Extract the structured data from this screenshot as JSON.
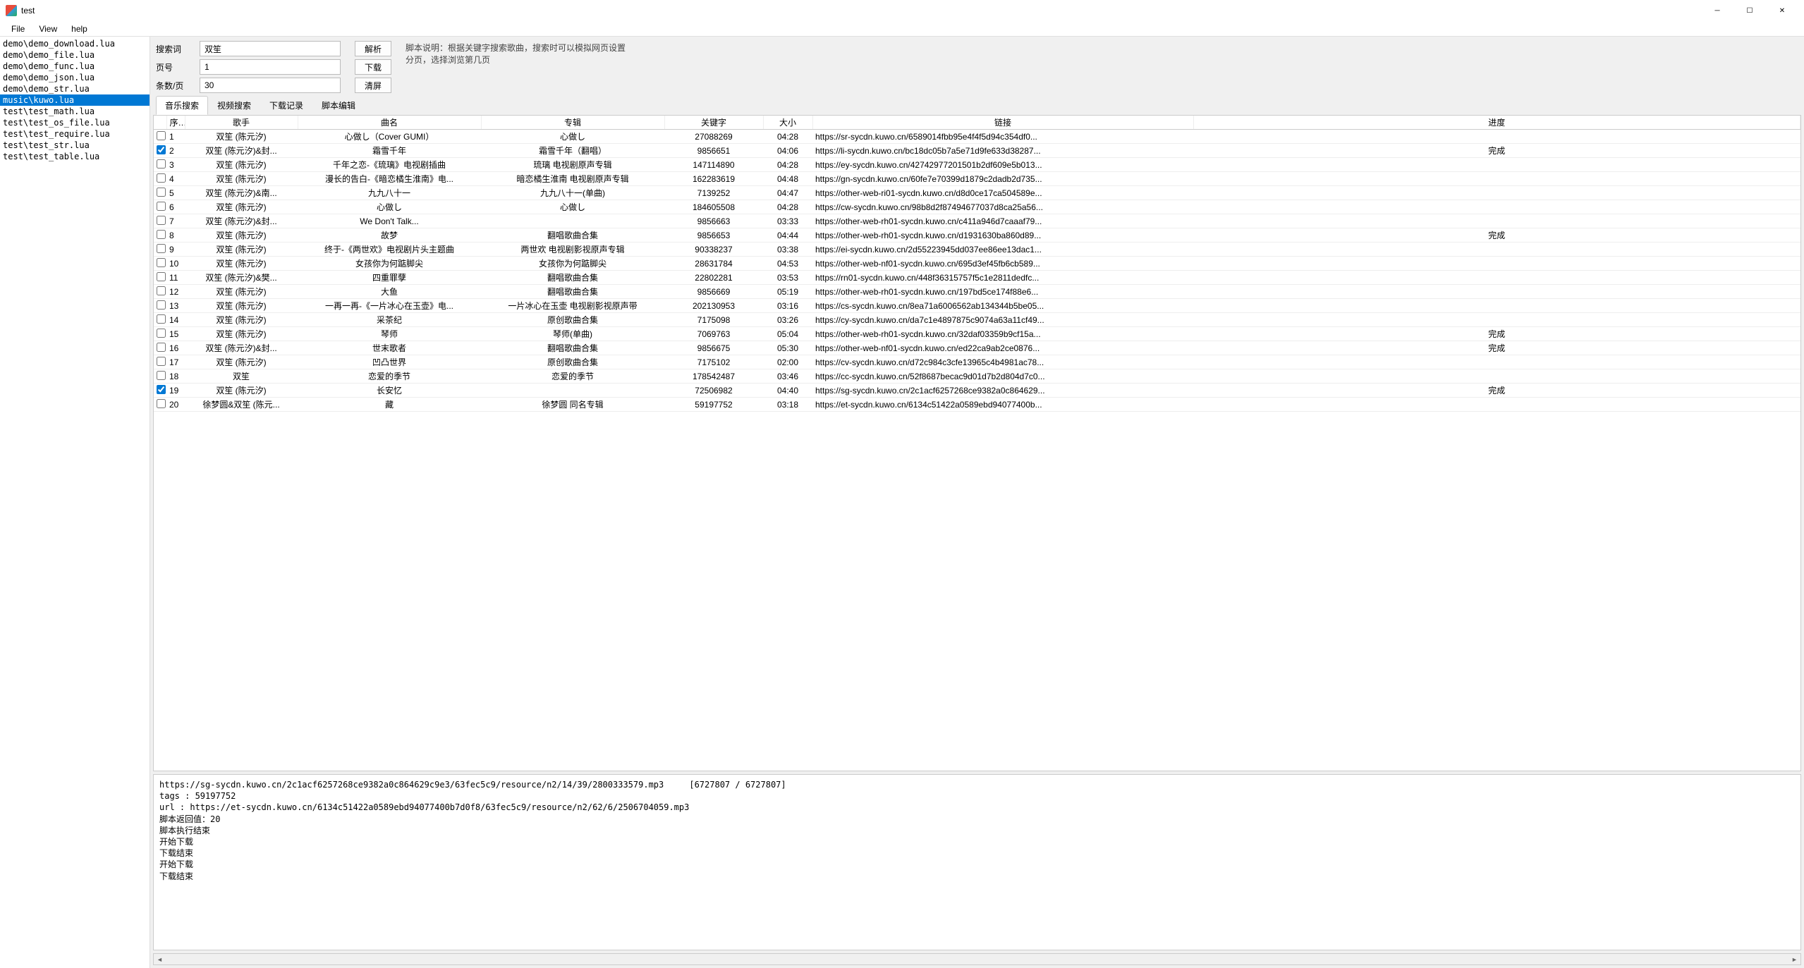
{
  "window": {
    "title": "test"
  },
  "menu": {
    "file": "File",
    "view": "View",
    "help": "help"
  },
  "sidebar": {
    "files": [
      "demo\\demo_download.lua",
      "demo\\demo_file.lua",
      "demo\\demo_func.lua",
      "demo\\demo_json.lua",
      "demo\\demo_str.lua",
      "music\\kuwo.lua",
      "test\\test_math.lua",
      "test\\test_os_file.lua",
      "test\\test_require.lua",
      "test\\test_str.lua",
      "test\\test_table.lua"
    ],
    "selected_index": 5
  },
  "form": {
    "labels": {
      "keyword": "搜索词",
      "page": "页号",
      "per_page": "条数/页"
    },
    "values": {
      "keyword": "双笙",
      "page": "1",
      "per_page": "30"
    }
  },
  "buttons": {
    "parse": "解析",
    "download": "下载",
    "clear": "清屏"
  },
  "description": "脚本说明：根据关键字搜索歌曲，搜索时可以模拟网页设置\n分页，选择浏览第几页",
  "tabs": {
    "items": [
      "音乐搜索",
      "视频搜索",
      "下载记录",
      "脚本编辑"
    ],
    "active_index": 0
  },
  "table": {
    "headers": {
      "idx": "序号",
      "artist": "歌手",
      "song": "曲名",
      "album": "专辑",
      "keyword": "关键字",
      "size": "大小",
      "url": "链接",
      "progress": "进度"
    },
    "rows": [
      {
        "checked": false,
        "artist": "双笙 (陈元汐)",
        "song": "心做し（Cover&nbsp;GUMI）",
        "album": "心做し",
        "keyword": "27088269",
        "size": "04:28",
        "url": "https://sr-sycdn.kuwo.cn/6589014fbb95e4f4f5d94c354df0...",
        "progress": ""
      },
      {
        "checked": true,
        "artist": "双笙 (陈元汐)&封...",
        "song": "霜雪千年",
        "album": "霜雪千年（翻唱）",
        "keyword": "9856651",
        "size": "04:06",
        "url": "https://li-sycdn.kuwo.cn/bc18dc05b7a5e71d9fe633d38287...",
        "progress": "完成"
      },
      {
        "checked": false,
        "artist": "双笙 (陈元汐)",
        "song": "千年之恋-《琉璃》电视剧插曲",
        "album": "琉璃 电视剧原声专辑",
        "keyword": "147114890",
        "size": "04:28",
        "url": "https://ey-sycdn.kuwo.cn/42742977201501b2df609e5b013...",
        "progress": ""
      },
      {
        "checked": false,
        "artist": "双笙 (陈元汐)",
        "song": "漫长的告白-《暗恋橘生淮南》电...",
        "album": "暗恋橘生淮南 电视剧原声专辑",
        "keyword": "162283619",
        "size": "04:48",
        "url": "https://gn-sycdn.kuwo.cn/60fe7e70399d1879c2dadb2d735...",
        "progress": ""
      },
      {
        "checked": false,
        "artist": "双笙 (陈元汐)&南...",
        "song": "九九八十一",
        "album": "九九八十一(单曲)",
        "keyword": "7139252",
        "size": "04:47",
        "url": "https://other-web-ri01-sycdn.kuwo.cn/d8d0ce17ca504589e...",
        "progress": ""
      },
      {
        "checked": false,
        "artist": "双笙 (陈元汐)",
        "song": "心做し",
        "album": "心做し",
        "keyword": "184605508",
        "size": "04:28",
        "url": "https://cw-sycdn.kuwo.cn/98b8d2f87494677037d8ca25a56...",
        "progress": ""
      },
      {
        "checked": false,
        "artist": "双笙 (陈元汐)&封...",
        "song": "We&nbsp;Don&apos;t&nbsp;Talk...",
        "album": "",
        "keyword": "9856663",
        "size": "03:33",
        "url": "https://other-web-rh01-sycdn.kuwo.cn/c411a946d7caaaf79...",
        "progress": ""
      },
      {
        "checked": false,
        "artist": "双笙 (陈元汐)",
        "song": "故梦",
        "album": "翻唱歌曲合集",
        "keyword": "9856653",
        "size": "04:44",
        "url": "https://other-web-rh01-sycdn.kuwo.cn/d1931630ba860d89...",
        "progress": "完成"
      },
      {
        "checked": false,
        "artist": "双笙 (陈元汐)",
        "song": "终于-《两世欢》电视剧片头主题曲",
        "album": "两世欢 电视剧影视原声专辑",
        "keyword": "90338237",
        "size": "03:38",
        "url": "https://ei-sycdn.kuwo.cn/2d55223945dd037ee86ee13dac1...",
        "progress": ""
      },
      {
        "checked": false,
        "artist": "双笙 (陈元汐)",
        "song": "女孩你为何踮脚尖",
        "album": "女孩你为何踮脚尖",
        "keyword": "28631784",
        "size": "04:53",
        "url": "https://other-web-nf01-sycdn.kuwo.cn/695d3ef45fb6cb589...",
        "progress": ""
      },
      {
        "checked": false,
        "artist": "双笙 (陈元汐)&樊...",
        "song": "四重罪孽",
        "album": "翻唱歌曲合集",
        "keyword": "22802281",
        "size": "03:53",
        "url": "https://rn01-sycdn.kuwo.cn/448f36315757f5c1e2811dedfc...",
        "progress": ""
      },
      {
        "checked": false,
        "artist": "双笙 (陈元汐)",
        "song": "大鱼",
        "album": "翻唱歌曲合集",
        "keyword": "9856669",
        "size": "05:19",
        "url": "https://other-web-rh01-sycdn.kuwo.cn/197bd5ce174f88e6...",
        "progress": ""
      },
      {
        "checked": false,
        "artist": "双笙 (陈元汐)",
        "song": "一再一再-《一片冰心在玉壶》电...",
        "album": "一片冰心在玉壶 电视剧影视原声带",
        "keyword": "202130953",
        "size": "03:16",
        "url": "https://cs-sycdn.kuwo.cn/8ea71a6006562ab134344b5be05...",
        "progress": ""
      },
      {
        "checked": false,
        "artist": "双笙 (陈元汐)",
        "song": "采茶纪",
        "album": "原创歌曲合集",
        "keyword": "7175098",
        "size": "03:26",
        "url": "https://cy-sycdn.kuwo.cn/da7c1e4897875c9074a63a11cf49...",
        "progress": ""
      },
      {
        "checked": false,
        "artist": "双笙 (陈元汐)",
        "song": "琴师",
        "album": "琴师(单曲)",
        "keyword": "7069763",
        "size": "05:04",
        "url": "https://other-web-rh01-sycdn.kuwo.cn/32daf03359b9cf15a...",
        "progress": "完成"
      },
      {
        "checked": false,
        "artist": "双笙 (陈元汐)&封...",
        "song": "世末歌者",
        "album": "翻唱歌曲合集",
        "keyword": "9856675",
        "size": "05:30",
        "url": "https://other-web-nf01-sycdn.kuwo.cn/ed22ca9ab2ce0876...",
        "progress": "完成"
      },
      {
        "checked": false,
        "artist": "双笙 (陈元汐)",
        "song": "凹凸世界",
        "album": "原创歌曲合集",
        "keyword": "7175102",
        "size": "02:00",
        "url": "https://cv-sycdn.kuwo.cn/d72c984c3cfe13965c4b4981ac78...",
        "progress": ""
      },
      {
        "checked": false,
        "artist": "双笙",
        "song": "恋爱的季节",
        "album": "恋爱的季节",
        "keyword": "178542487",
        "size": "03:46",
        "url": "https://cc-sycdn.kuwo.cn/52f8687becac9d01d7b2d804d7c0...",
        "progress": ""
      },
      {
        "checked": true,
        "artist": "双笙 (陈元汐)",
        "song": "长安忆",
        "album": "",
        "keyword": "72506982",
        "size": "04:40",
        "url": "https://sg-sycdn.kuwo.cn/2c1acf6257268ce9382a0c864629...",
        "progress": "完成"
      },
      {
        "checked": false,
        "artist": "徐梦圆&双笙 (陈元...",
        "song": "藏",
        "album": "徐梦圆 同名专辑",
        "keyword": "59197752",
        "size": "03:18",
        "url": "https://et-sycdn.kuwo.cn/6134c51422a0589ebd94077400b...",
        "progress": ""
      }
    ]
  },
  "log": "https://sg-sycdn.kuwo.cn/2c1acf6257268ce9382a0c864629c9e3/63fec5c9/resource/n2/14/39/2800333579.mp3     [6727807 / 6727807]\ntags : 59197752\nurl : https://et-sycdn.kuwo.cn/6134c51422a0589ebd94077400b7d0f8/63fec5c9/resource/n2/62/6/2506704059.mp3\n脚本返回值：20\n脚本执行结束\n开始下载\n下载结束\n开始下载\n下载结束"
}
